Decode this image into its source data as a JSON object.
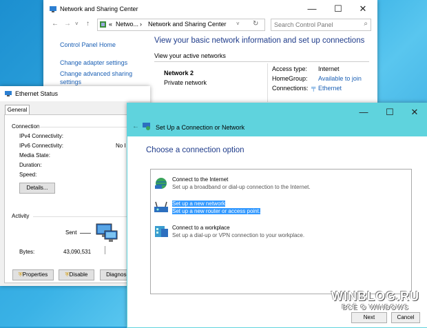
{
  "nsc": {
    "title": "Network and Sharing Center",
    "breadcrumb": [
      "«",
      "Netwo...",
      "›",
      "Network and Sharing Center"
    ],
    "search_placeholder": "Search Control Panel",
    "left_links": [
      "Control Panel Home",
      "Change adapter settings",
      "Change advanced sharing settings"
    ],
    "heading": "View your basic network information and set up connections",
    "active_networks_label": "View your active networks",
    "network_name": "Network 2",
    "network_type": "Private network",
    "access_type_label": "Access type:",
    "access_type_value": "Internet",
    "homegroup_label": "HomeGroup:",
    "homegroup_value": "Available to join",
    "connections_label": "Connections:",
    "connections_value": "Ethernet"
  },
  "eth": {
    "title": "Ethernet Status",
    "tab": "General",
    "connection_label": "Connection",
    "rows": [
      {
        "label": "IPv4 Connectivity:",
        "value": ""
      },
      {
        "label": "IPv6 Connectivity:",
        "value": "No I"
      },
      {
        "label": "Media State:",
        "value": ""
      },
      {
        "label": "Duration:",
        "value": ""
      },
      {
        "label": "Speed:",
        "value": ""
      }
    ],
    "details_button": "Details...",
    "activity_label": "Activity",
    "sent_label": "Sent",
    "bytes_label": "Bytes:",
    "bytes_value": "43,090,531",
    "properties_button": "Properties",
    "disable_button": "Disable",
    "diagnose_button": "Diagnose"
  },
  "wizard": {
    "title": "Set Up a Connection or Network",
    "heading": "Choose a connection option",
    "options": [
      {
        "title": "Connect to the Internet",
        "desc": "Set up a broadband or dial-up connection to the Internet."
      },
      {
        "title": "Set up a new network",
        "desc": "Set up a new router or access point."
      },
      {
        "title": "Connect to a workplace",
        "desc": "Set up a dial-up or VPN connection to your workplace."
      }
    ],
    "next_button": "Next",
    "cancel_button": "Cancel"
  },
  "watermark": {
    "line1": "WINBLOG.RU",
    "line2": "ВСЁ О WINDOWS"
  },
  "colors": {
    "accent": "#5fd3dd",
    "link": "#1a5fb4",
    "selection": "#3399ff"
  }
}
